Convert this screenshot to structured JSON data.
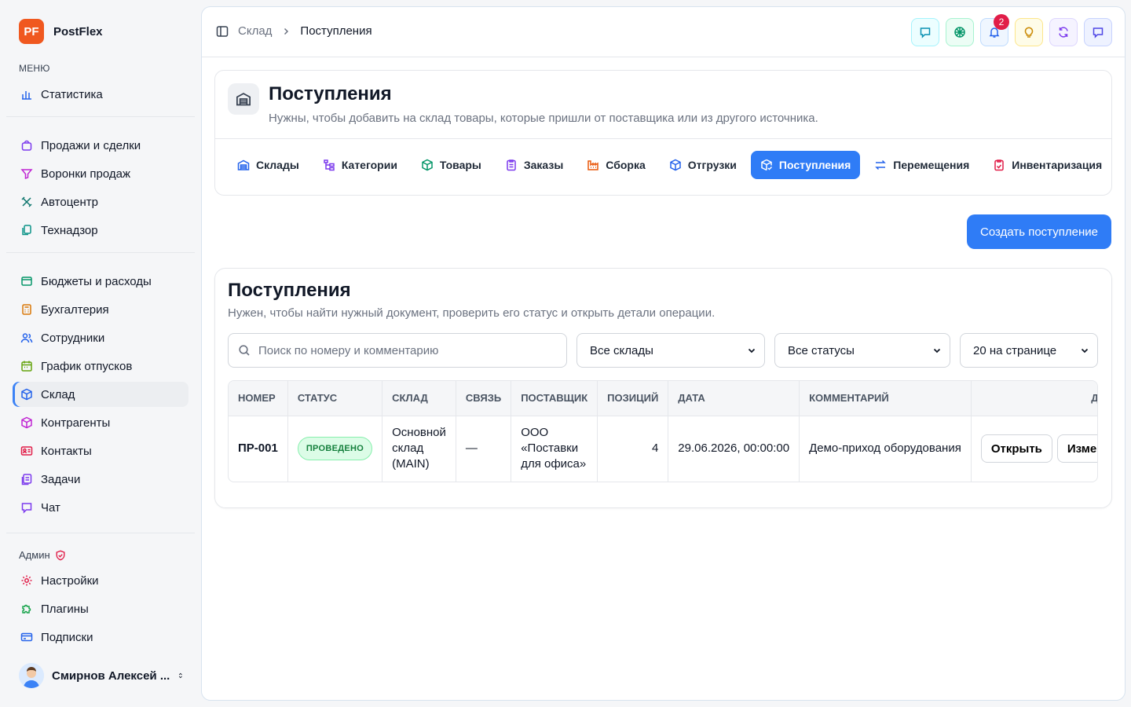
{
  "app": {
    "logo_text": "PF",
    "name": "PostFlex"
  },
  "sidebar": {
    "menu_caption": "МЕНЮ",
    "group1": [
      {
        "label": "Статистика",
        "icon": "bar-chart-icon"
      }
    ],
    "group2": [
      {
        "label": "Продажи и сделки",
        "icon": "shopping-bag-icon"
      },
      {
        "label": "Воронки продаж",
        "icon": "funnel-icon"
      },
      {
        "label": "Автоцентр",
        "icon": "wrench-icon"
      },
      {
        "label": "Технадзор",
        "icon": "clipboard-copy-icon"
      }
    ],
    "group3": [
      {
        "label": "Бюджеты и расходы",
        "icon": "wallet-icon"
      },
      {
        "label": "Бухгалтерия",
        "icon": "calculator-icon"
      },
      {
        "label": "Сотрудники",
        "icon": "users-icon"
      },
      {
        "label": "График отпусков",
        "icon": "calendar-icon"
      },
      {
        "label": "Склад",
        "icon": "box-icon"
      },
      {
        "label": "Контрагенты",
        "icon": "cube-icon"
      },
      {
        "label": "Контакты",
        "icon": "contact-card-icon"
      },
      {
        "label": "Задачи",
        "icon": "tasks-icon"
      },
      {
        "label": "Чат",
        "icon": "chat-icon"
      }
    ],
    "admin_caption": "Админ",
    "admin": [
      {
        "label": "Настройки",
        "icon": "settings-icon"
      },
      {
        "label": "Плагины",
        "icon": "puzzle-icon"
      },
      {
        "label": "Подписки",
        "icon": "credit-card-icon"
      }
    ],
    "user_name": "Смирнов Алексей ..."
  },
  "breadcrumb": {
    "parent": "Склад",
    "current": "Поступления"
  },
  "notifications_count": "2",
  "hero": {
    "title": "Поступления",
    "subtitle": "Нужны, чтобы добавить на склад товары, которые пришли от поставщика или из другого источника."
  },
  "tabs": [
    "Склады",
    "Категории",
    "Товары",
    "Заказы",
    "Сборка",
    "Отгрузки",
    "Поступления",
    "Перемещения",
    "Инвентаризация"
  ],
  "create_button": "Создать поступление",
  "list": {
    "title": "Поступления",
    "subtitle": "Нужен, чтобы найти нужный документ, проверить его статус и открыть детали операции.",
    "search_placeholder": "Поиск по номеру и комментарию",
    "warehouse_filter": "Все склады",
    "status_filter": "Все статусы",
    "page_size": "20 на странице"
  },
  "table": {
    "headers": [
      "НОМЕР",
      "СТАТУС",
      "СКЛАД",
      "СВЯЗЬ",
      "ПОСТАВЩИК",
      "ПОЗИЦИЙ",
      "ДАТА",
      "КОММЕНТАРИЙ",
      "ДЕЙСТ"
    ],
    "rows": [
      {
        "number": "ПР-001",
        "status": "ПРОВЕДЕНО",
        "warehouse": "Основной склад (MAIN)",
        "link": "—",
        "supplier": "ООО «Поставки для офиса»",
        "positions": "4",
        "date": "29.06.2026, 00:00:00",
        "comment": "Демо-приход оборудования",
        "open_label": "Открыть",
        "edit_label": "Измени"
      }
    ]
  }
}
